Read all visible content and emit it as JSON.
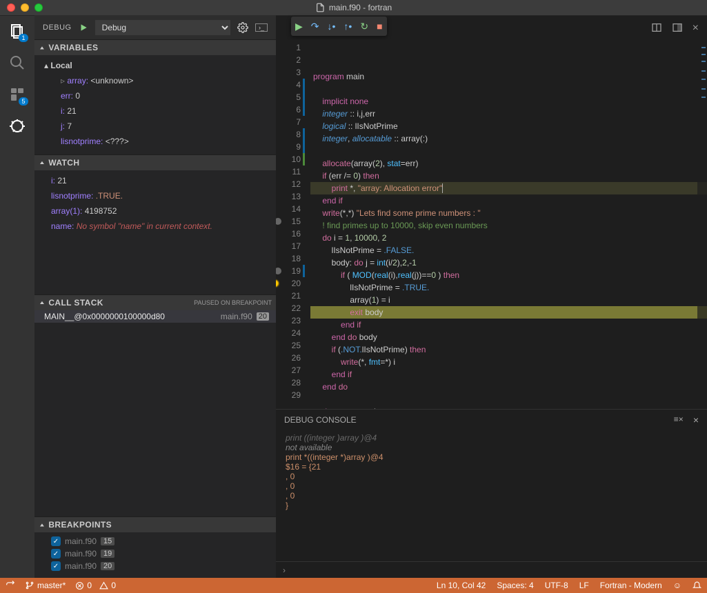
{
  "window": {
    "title": "main.f90 - fortran",
    "file_icon": "file-icon"
  },
  "activity": {
    "explorer_badge": "1",
    "ext_badge": "5"
  },
  "debug": {
    "label": "DEBUG",
    "config": "Debug",
    "sections": {
      "variables": "VARIABLES",
      "local": "Local",
      "watch": "WATCH",
      "callstack": "CALL STACK",
      "paused": "PAUSED ON BREAKPOINT",
      "breakpoints": "BREAKPOINTS"
    },
    "locals": {
      "array": {
        "name": "array:",
        "value": "<unknown>"
      },
      "err": {
        "name": "err:",
        "value": "0"
      },
      "i": {
        "name": "i:",
        "value": "21"
      },
      "j": {
        "name": "j:",
        "value": "7"
      },
      "lisnotprime": {
        "name": "lisnotprime:",
        "value": "<???>"
      }
    },
    "watch": {
      "i": {
        "name": "i:",
        "value": "21"
      },
      "lnp": {
        "name": "lisnotprime:",
        "value": ".TRUE."
      },
      "arr": {
        "name": "array(1):",
        "value": "4198752"
      },
      "nm": {
        "name": "name:",
        "value": "No symbol \"name\" in current context."
      }
    },
    "stack": {
      "frame": "MAIN__@0x0000000100000d80",
      "file": "main.f90",
      "line": "20"
    },
    "breakpoints": [
      {
        "file": "main.f90",
        "line": "15"
      },
      {
        "file": "main.f90",
        "line": "19"
      },
      {
        "file": "main.f90",
        "line": "20"
      }
    ]
  },
  "editor": {
    "lines": 29,
    "current": 20,
    "highlighted": 10,
    "code": {
      "l1": "program main",
      "l3": "    implicit none",
      "l4": "    integer :: i,j,err",
      "l5": "    logical :: lIsNotPrime",
      "l6": "    integer, allocatable :: array(:)",
      "l8": "    allocate(array(2), stat=err)",
      "l9": "    if (err /= 0) then",
      "l10": "        print *, \"array: Allocation error\"",
      "l11": "    end if",
      "l12": "    write(*,*) \"Lets find some prime numbers : \"",
      "l13": "    ! find primes up to 10000, skip even numbers",
      "l14": "    do i = 1, 10000, 2",
      "l15": "        lIsNotPrime = .FALSE.",
      "l16": "        body: do j = int(i/2),2,-1",
      "l17": "            if ( MOD(real(i),real(j))==0 ) then",
      "l18": "                lIsNotPrime = .TRUE.",
      "l19": "                array(1) = i",
      "l20": "                exit body",
      "l21": "            end if",
      "l22": "        end do body",
      "l23": "        if (.NOT.lIsNotPrime) then",
      "l24": "            write(*, fmt=*) i",
      "l25": "        end if",
      "l26": "    end do",
      "l28": "end program main"
    }
  },
  "console": {
    "title": "DEBUG CONSOLE",
    "l0a": "print  ((integer  )array )@4",
    "l0b": "not available",
    "l1": "print *((integer *)array )@4",
    "l2": "$16 = {21",
    "l3": ", 0",
    "l4": ", 0",
    "l5": ", 0",
    "l6": "}"
  },
  "status": {
    "branch": "master*",
    "errors": "0",
    "warnings": "0",
    "pos": "Ln 10, Col 42",
    "spaces": "Spaces: 4",
    "enc": "UTF-8",
    "eol": "LF",
    "lang": "Fortran - Modern"
  }
}
